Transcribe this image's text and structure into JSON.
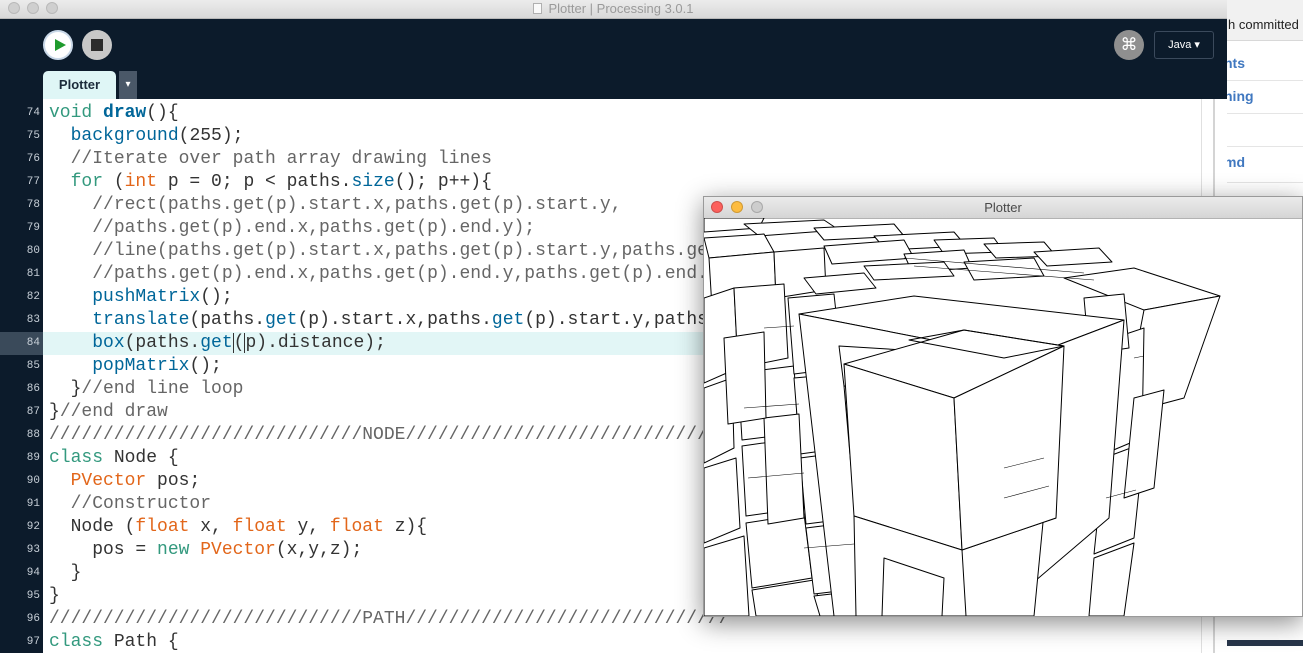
{
  "background_window": {
    "header_fragment": "h committed",
    "links": [
      "nts",
      "ning",
      "md"
    ]
  },
  "ide": {
    "window_title": "Plotter | Processing 3.0.1",
    "toolbar": {
      "run_icon": "play-icon",
      "stop_icon": "stop-icon",
      "debug_icon": "butterfly-icon",
      "debug_glyph": "⌘",
      "mode_label": "Java ▾"
    },
    "tabs": [
      {
        "label": "Plotter"
      }
    ],
    "tab_menu_glyph": "▾",
    "current_line": 84
  },
  "editor": {
    "lines": [
      {
        "n": "74",
        "html": "<span class=\"kw2\">void</span> <span class=\"fnb\">draw</span>(){"
      },
      {
        "n": "75",
        "html": "  <span class=\"fn\">background</span>(255);"
      },
      {
        "n": "76",
        "html": "  <span class=\"cm\">//Iterate over path array drawing lines</span>"
      },
      {
        "n": "77",
        "html": "  <span class=\"kw2\">for</span> (<span class=\"kw\">int</span> p = 0; p &lt; paths.<span class=\"fn\">size</span>(); p++){"
      },
      {
        "n": "78",
        "html": "    <span class=\"cm\">//rect(paths.get(p).start.x,paths.get(p).start.y,</span>"
      },
      {
        "n": "79",
        "html": "    <span class=\"cm\">//paths.get(p).end.x,paths.get(p).end.y);</span>"
      },
      {
        "n": "80",
        "html": "    <span class=\"cm\">//line(paths.get(p).start.x,paths.get(p).start.y,paths.get(p).start.z,</span>"
      },
      {
        "n": "81",
        "html": "    <span class=\"cm\">//paths.get(p).end.x,paths.get(p).end.y,paths.get(p).end.z);</span>"
      },
      {
        "n": "82",
        "html": "    <span class=\"fn\">pushMatrix</span>();"
      },
      {
        "n": "83",
        "html": "    <span class=\"fn\">translate</span>(paths.<span class=\"fn\">get</span>(p).start.x,paths.<span class=\"fn\">get</span>(p).start.y,paths.get(p).start.z);"
      },
      {
        "n": "84",
        "html": "    <span class=\"fn\">box</span>(paths.<span class=\"fn\">get</span><span class=\"caret\">(</span>p).distance);"
      },
      {
        "n": "85",
        "html": "    <span class=\"fn\">popMatrix</span>();"
      },
      {
        "n": "86",
        "html": "  }<span class=\"cm\">//end line loop</span>"
      },
      {
        "n": "87",
        "html": "}<span class=\"cm\">//end draw</span>"
      },
      {
        "n": "88",
        "html": "<span class=\"cm\">/////////////////////////////NODE//////////////////////////////</span>"
      },
      {
        "n": "89",
        "html": "<span class=\"kw2\">class</span> Node {"
      },
      {
        "n": "90",
        "html": "  <span class=\"kw\">PVector</span> pos;"
      },
      {
        "n": "91",
        "html": "  <span class=\"cm\">//Constructor</span>"
      },
      {
        "n": "92",
        "html": "  Node (<span class=\"kw\">float</span> x, <span class=\"kw\">float</span> y, <span class=\"kw\">float</span> z){"
      },
      {
        "n": "93",
        "html": "    pos = <span class=\"kw2\">new</span> <span class=\"kw\">PVector</span>(x,y,z);"
      },
      {
        "n": "94",
        "html": "  }"
      },
      {
        "n": "95",
        "html": "}"
      },
      {
        "n": "96",
        "html": "<span class=\"cm\">/////////////////////////////PATH//////////////////////////////</span>"
      },
      {
        "n": "97",
        "html": "<span class=\"kw2\">class</span> Path {"
      }
    ]
  },
  "sketch_window": {
    "title": "Plotter",
    "controls": [
      "close",
      "minimize",
      "zoom"
    ],
    "colors": {
      "close": "#fc605c",
      "minimize": "#fdbc40",
      "zoom": "#cdcdcd"
    }
  },
  "colors": {
    "ide_background": "#0c1b2b",
    "current_line": "#e2f6f6",
    "keyword_orange": "#e2661a",
    "keyword_green": "#33997e",
    "function_blue": "#006699",
    "comment_gray": "#666666"
  }
}
